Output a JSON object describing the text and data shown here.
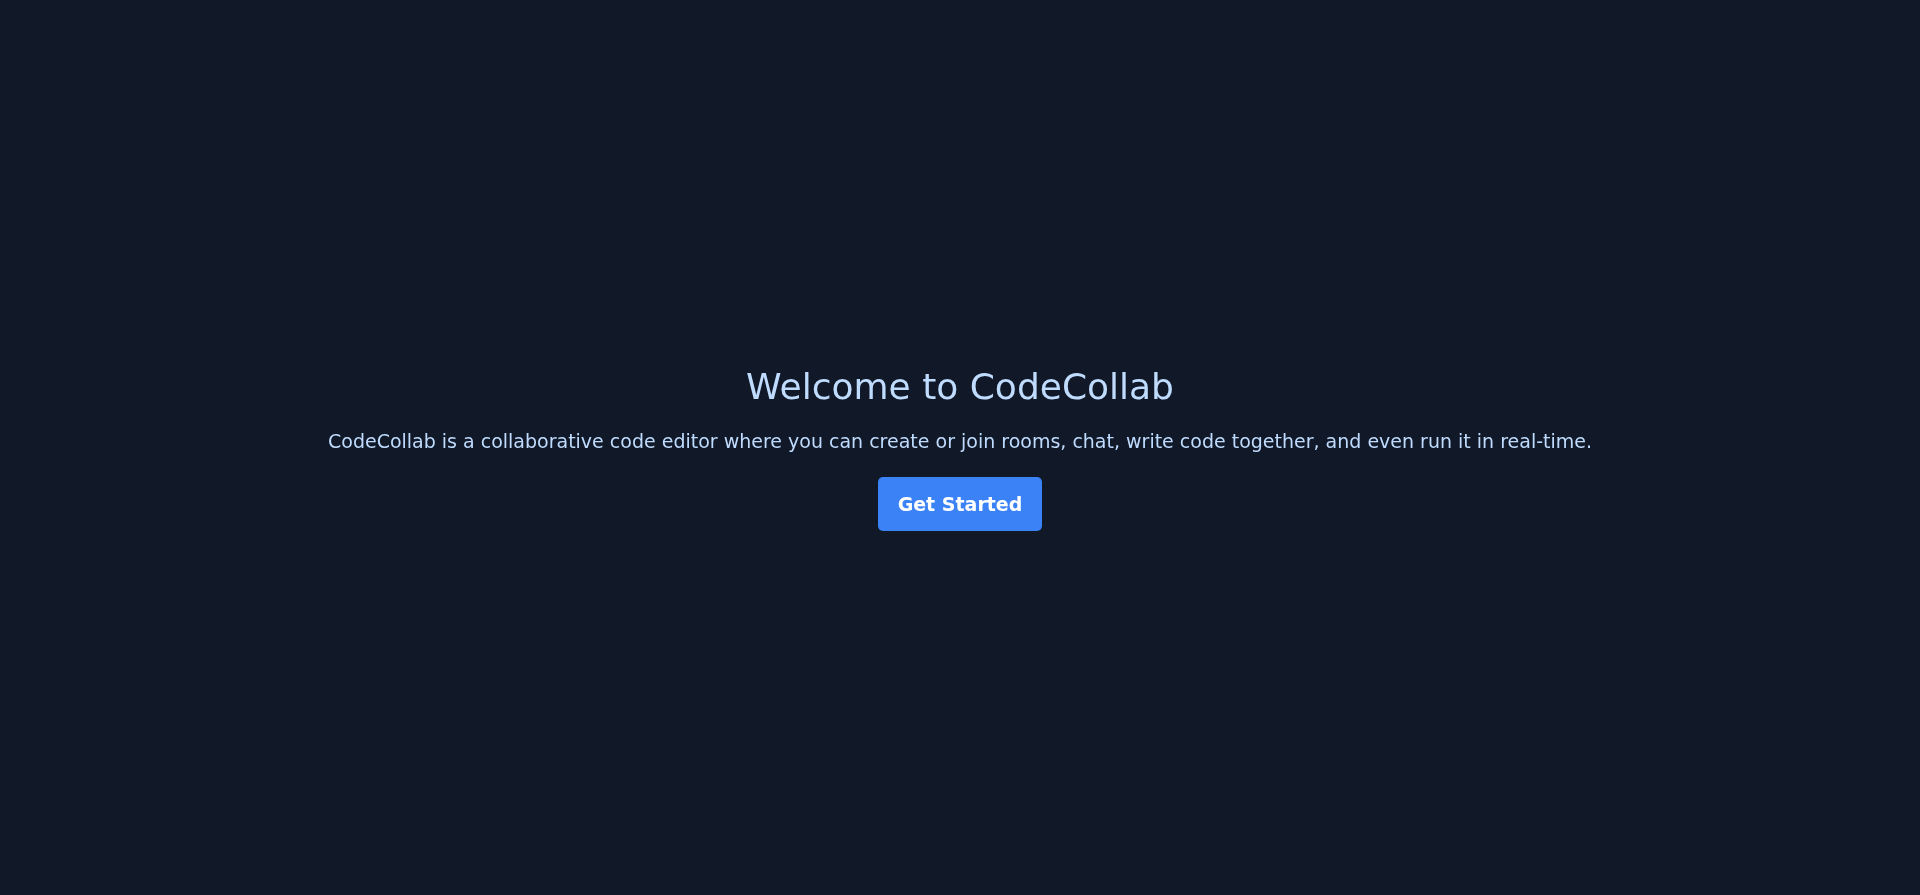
{
  "hero": {
    "title": "Welcome to CodeCollab",
    "description": "CodeCollab is a collaborative code editor where you can create or join rooms, chat, write code together, and even run it in real-time.",
    "button": "Get Started"
  }
}
